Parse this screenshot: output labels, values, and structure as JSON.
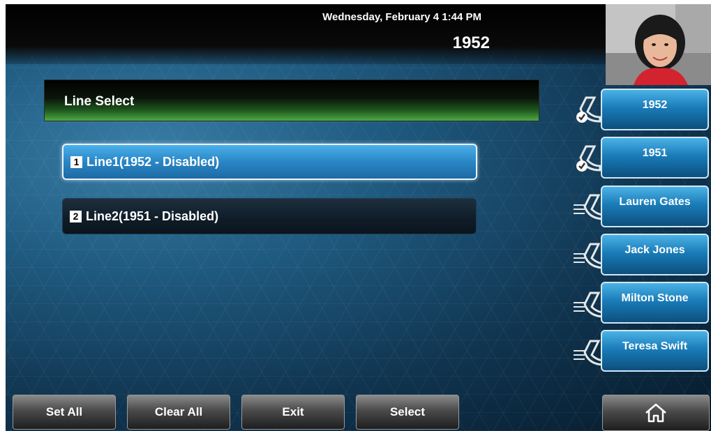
{
  "header": {
    "datetime": "Wednesday, February 4  1:44 PM",
    "extension": "1952"
  },
  "screen": {
    "title": "Line Select",
    "lines": [
      {
        "number": "1",
        "label": "Line1(1952 - Disabled)",
        "selected": true
      },
      {
        "number": "2",
        "label": "Line2(1951 - Disabled)",
        "selected": false
      }
    ]
  },
  "line_keys": [
    {
      "label": "1952",
      "icon": "line-registered-icon"
    },
    {
      "label": "1951",
      "icon": "line-registered-icon"
    },
    {
      "label": "Lauren Gates",
      "icon": "speed-dial-icon"
    },
    {
      "label": "Jack Jones",
      "icon": "speed-dial-icon"
    },
    {
      "label": "Milton Stone",
      "icon": "speed-dial-icon"
    },
    {
      "label": "Teresa Swift",
      "icon": "speed-dial-icon"
    }
  ],
  "softkeys": [
    "Set All",
    "Clear All",
    "Exit",
    "Select"
  ],
  "home_icon": "home-icon",
  "colors": {
    "title_bar_green": "#4fa844",
    "selected_blue": "#2a86c6",
    "line_key_blue": "#1a7cb8"
  }
}
